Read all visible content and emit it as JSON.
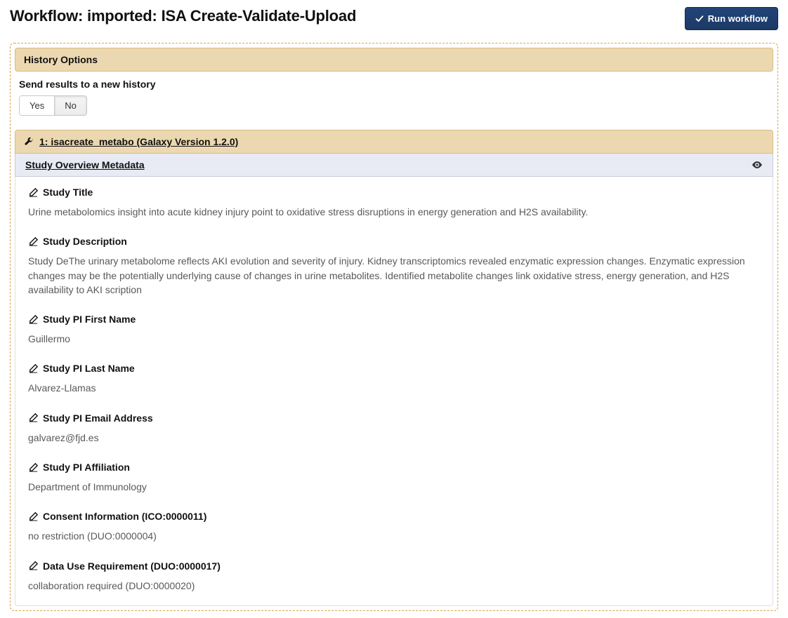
{
  "header": {
    "title": "Workflow: imported: ISA Create-Validate-Upload",
    "run_button": "Run workflow"
  },
  "history_panel": {
    "header": "History Options",
    "send_label": "Send results to a new history",
    "yes": "Yes",
    "no": "No"
  },
  "tool": {
    "title": "1: isacreate_metabo (Galaxy Version 1.2.0)"
  },
  "section": {
    "title": "Study Overview Metadata"
  },
  "fields": {
    "study_title": {
      "label": "Study Title",
      "value": "Urine metabolomics insight into acute kidney injury point to oxidative stress disruptions in energy generation and H2S availability."
    },
    "study_description": {
      "label": "Study Description",
      "value": "Study DeThe urinary metabolome reflects AKI evolution and severity of injury. Kidney transcriptomics revealed enzymatic expression changes. Enzymatic expression changes may be the potentially underlying cause of changes in urine metabolites. Identified metabolite changes link oxidative stress, energy generation, and H2S availability to AKI scription"
    },
    "pi_first": {
      "label": "Study PI First Name",
      "value": "Guillermo"
    },
    "pi_last": {
      "label": "Study PI Last Name",
      "value": "Alvarez-Llamas"
    },
    "pi_email": {
      "label": "Study PI Email Address",
      "value": "galvarez@fjd.es"
    },
    "pi_affiliation": {
      "label": "Study PI Affiliation",
      "value": "Department of Immunology"
    },
    "consent": {
      "label": "Consent Information (ICO:0000011)",
      "value": "no restriction (DUO:0000004)"
    },
    "data_use": {
      "label": "Data Use Requirement (DUO:0000017)",
      "value": "collaboration required (DUO:0000020)"
    }
  }
}
